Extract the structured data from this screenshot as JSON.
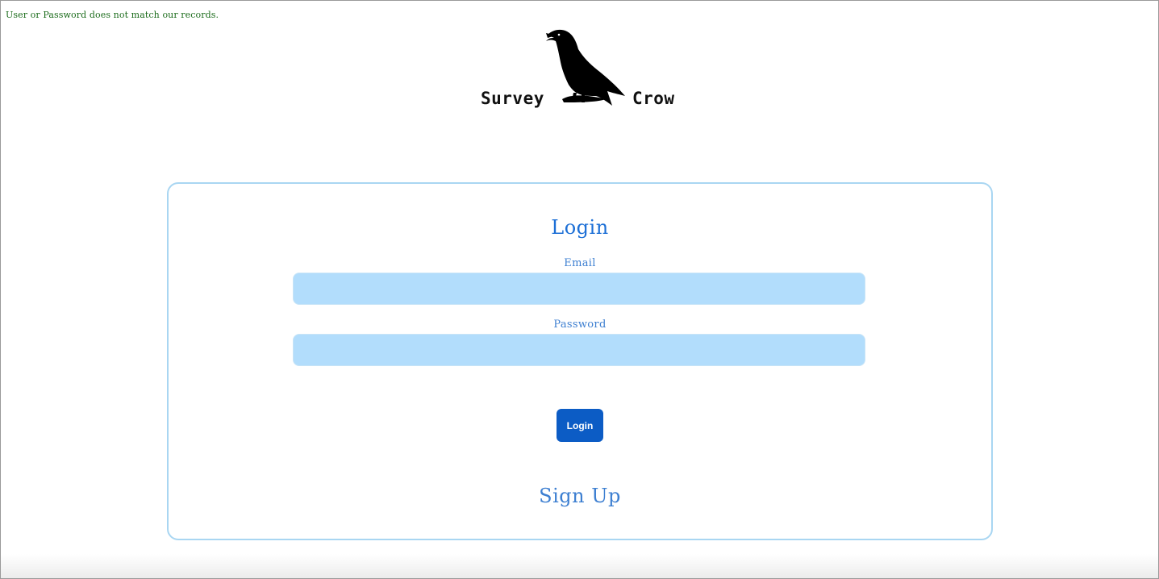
{
  "error": {
    "message": "User or Password does not match our records."
  },
  "brand": {
    "word_left": "Survey",
    "word_right": "Crow",
    "logo_icon": "crow-icon"
  },
  "login_form": {
    "title": "Login",
    "email_label": "Email",
    "email_value": "",
    "email_placeholder": "",
    "password_label": "Password",
    "password_value": "",
    "password_placeholder": "",
    "submit_label": "Login",
    "signup_label": "Sign Up"
  },
  "colors": {
    "error_text": "#1a6b1a",
    "card_border": "#a9d6f2",
    "title": "#1c6fd6",
    "label": "#3d7fd1",
    "input_bg": "#b2ddfc",
    "button_bg": "#0c5cc5",
    "button_text": "#ffffff"
  }
}
